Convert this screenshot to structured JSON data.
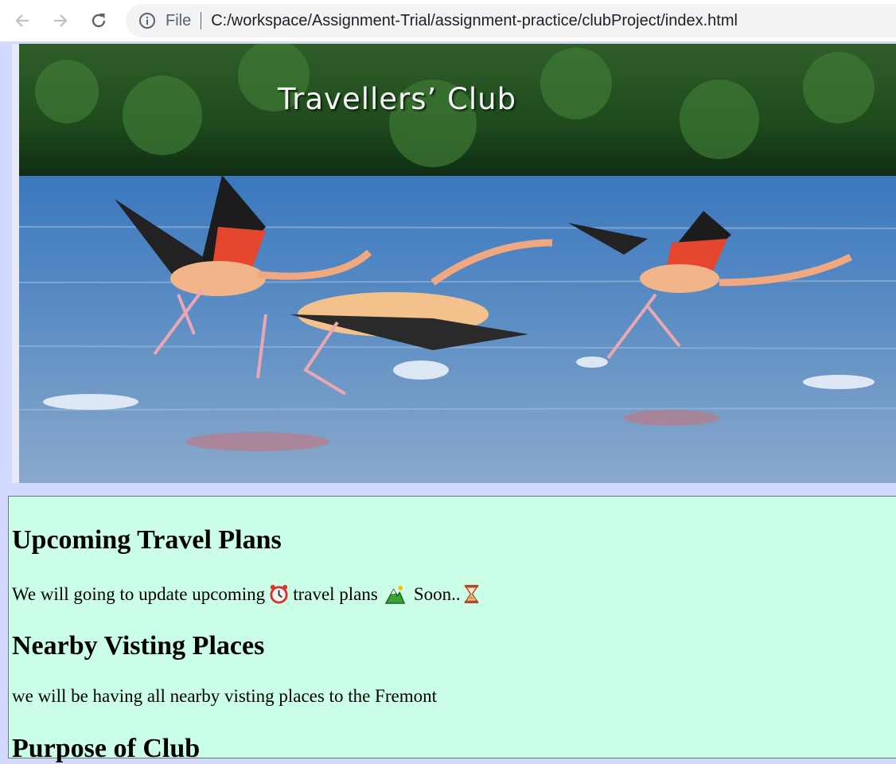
{
  "browser": {
    "scheme_label": "File",
    "url": "C:/workspace/Assignment-Trial/assignment-practice/clubProject/index.html"
  },
  "banner": {
    "title": "Travellers’ Club"
  },
  "sections": [
    {
      "heading": "Upcoming Travel Plans",
      "text_parts": [
        "We will going to update upcoming",
        "travel plans",
        "Soon..",
        ""
      ]
    },
    {
      "heading": "Nearby Visting Places",
      "text": "we will be having all nearby visting places to the Fremont"
    },
    {
      "heading": "Purpose of Club"
    }
  ],
  "icons": [
    "back-icon",
    "forward-icon",
    "reload-icon",
    "info-icon",
    "alarm-clock-icon",
    "mountain-icon",
    "hourglass-icon"
  ]
}
